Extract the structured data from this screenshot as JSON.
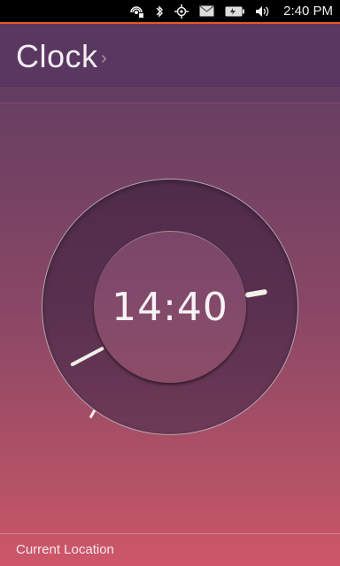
{
  "status_bar": {
    "icons": [
      "hotspot-icon",
      "bluetooth-icon",
      "location-icon",
      "messages-icon",
      "battery-icon",
      "volume-icon"
    ],
    "time": "2:40 PM"
  },
  "header": {
    "title": "Clock",
    "chevron": "›"
  },
  "clock": {
    "time": "14:40"
  },
  "bottom": {
    "label": "Current Location"
  },
  "colors": {
    "status_accent": "#e85a1c",
    "header_bg": "#5a3760",
    "gradient_top": "#5b3864",
    "gradient_bottom": "#cf5669",
    "hand": "#f3efe9"
  }
}
